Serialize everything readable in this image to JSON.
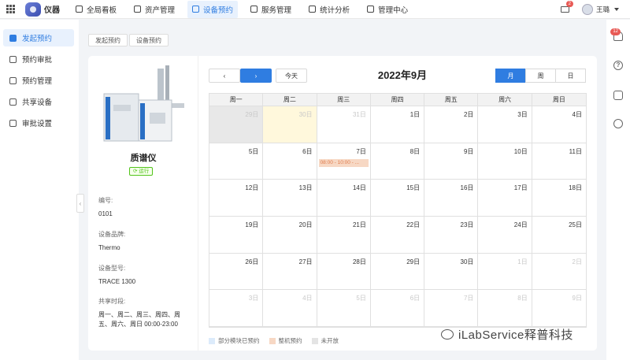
{
  "header": {
    "brand": "仪器",
    "nav": [
      {
        "label": "全局看板",
        "icon": "dashboard-icon"
      },
      {
        "label": "资产管理",
        "icon": "asset-icon"
      },
      {
        "label": "设备预约",
        "icon": "calendar-icon",
        "active": true
      },
      {
        "label": "服务管理",
        "icon": "service-icon"
      },
      {
        "label": "统计分析",
        "icon": "chart-icon"
      },
      {
        "label": "管理中心",
        "icon": "gear-icon"
      }
    ],
    "mail_badge": "2",
    "user_name": "王璐"
  },
  "sidebar": {
    "items": [
      {
        "label": "发起预约",
        "active": true
      },
      {
        "label": "预约审批"
      },
      {
        "label": "预约管理"
      },
      {
        "label": "共享设备"
      },
      {
        "label": "审批设置"
      }
    ]
  },
  "right_rail": {
    "notification_badge": "12"
  },
  "breadcrumb": [
    "发起预约",
    "设备预约"
  ],
  "device": {
    "name": "质谱仪",
    "status": "运行",
    "fields": [
      {
        "label": "编号:",
        "value": "0101"
      },
      {
        "label": "设备品牌:",
        "value": "Thermo"
      },
      {
        "label": "设备型号:",
        "value": "TRACE 1300"
      },
      {
        "label": "共享时段:",
        "value": "周一、周二、周三、周四、周五、周六、周日 00:00-23:00"
      }
    ]
  },
  "calendar": {
    "prev_label": "‹",
    "next_label": "›",
    "today_label": "今天",
    "title": "2022年9月",
    "views": [
      {
        "label": "月",
        "active": true
      },
      {
        "label": "周"
      },
      {
        "label": "日"
      }
    ],
    "weekdays": [
      "周一",
      "周二",
      "周三",
      "周四",
      "周五",
      "周六",
      "周日"
    ],
    "days": [
      {
        "label": "29日",
        "other": true,
        "past": true
      },
      {
        "label": "30日",
        "other": true,
        "today": true
      },
      {
        "label": "31日",
        "other": true
      },
      {
        "label": "1日"
      },
      {
        "label": "2日"
      },
      {
        "label": "3日"
      },
      {
        "label": "4日"
      },
      {
        "label": "5日"
      },
      {
        "label": "6日"
      },
      {
        "label": "7日",
        "event": "08:00 - 10:00 - ..."
      },
      {
        "label": "8日"
      },
      {
        "label": "9日"
      },
      {
        "label": "10日"
      },
      {
        "label": "11日"
      },
      {
        "label": "12日"
      },
      {
        "label": "13日"
      },
      {
        "label": "14日"
      },
      {
        "label": "15日"
      },
      {
        "label": "16日"
      },
      {
        "label": "17日"
      },
      {
        "label": "18日"
      },
      {
        "label": "19日"
      },
      {
        "label": "20日"
      },
      {
        "label": "21日"
      },
      {
        "label": "22日"
      },
      {
        "label": "23日"
      },
      {
        "label": "24日"
      },
      {
        "label": "25日"
      },
      {
        "label": "26日"
      },
      {
        "label": "27日"
      },
      {
        "label": "28日"
      },
      {
        "label": "29日"
      },
      {
        "label": "30日"
      },
      {
        "label": "1日",
        "other": true
      },
      {
        "label": "2日",
        "other": true
      },
      {
        "label": "3日",
        "other": true
      },
      {
        "label": "4日",
        "other": true
      },
      {
        "label": "5日",
        "other": true
      },
      {
        "label": "6日",
        "other": true
      },
      {
        "label": "7日",
        "other": true
      },
      {
        "label": "8日",
        "other": true
      },
      {
        "label": "9日",
        "other": true
      }
    ],
    "legend": [
      {
        "label": "部分模块已预约",
        "color": "#dcebfb"
      },
      {
        "label": "整机预约",
        "color": "#f7d8c4"
      },
      {
        "label": "未开放",
        "color": "#e4e4e4"
      }
    ]
  },
  "watermark": "iLabService释普科技"
}
